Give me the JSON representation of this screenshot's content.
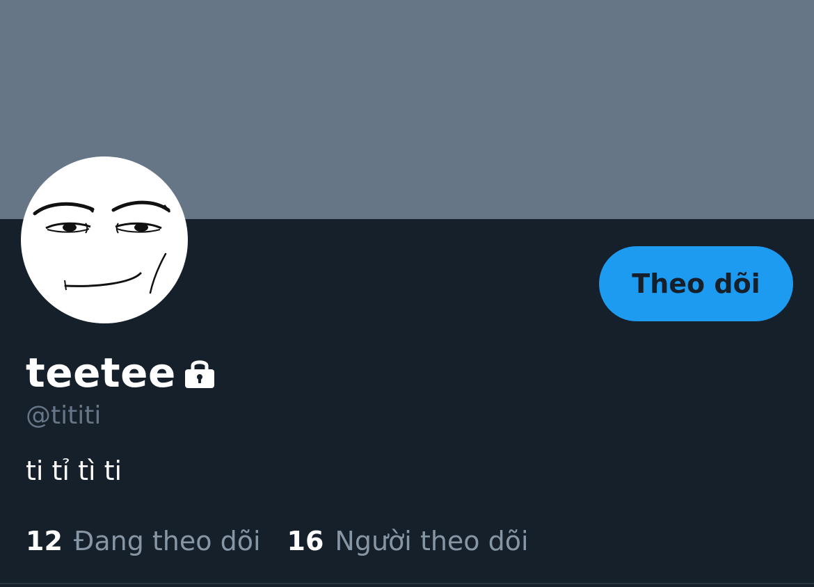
{
  "profile": {
    "display_name": "teetee",
    "handle": "@tititi",
    "bio": "ti tỉ tì ti",
    "protected_icon": "lock-icon",
    "avatar_icon": "meme-face-avatar"
  },
  "actions": {
    "follow_label": "Theo dõi"
  },
  "stats": {
    "following_count": "12",
    "following_label": "Đang theo dõi",
    "followers_count": "16",
    "followers_label": "Người theo dõi"
  },
  "colors": {
    "banner": "#667686",
    "background": "#16202b",
    "accent": "#1d9bf0",
    "secondary_text": "#8796a5"
  }
}
